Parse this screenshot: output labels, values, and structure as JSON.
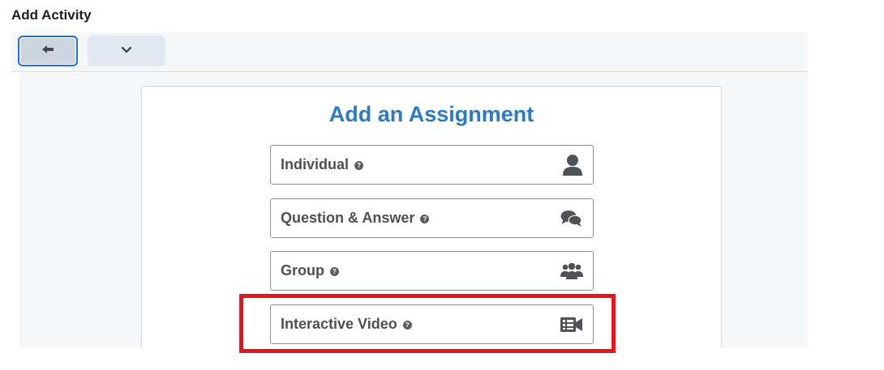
{
  "page": {
    "title": "Add Activity"
  },
  "toolbar": {
    "back_icon": "arrow-left-icon",
    "menu_icon": "chevron-down-icon"
  },
  "assignment": {
    "heading": "Add an Assignment",
    "options": [
      {
        "label": "Individual",
        "help": "?",
        "icon": "person-icon"
      },
      {
        "label": "Question & Answer",
        "help": "?",
        "icon": "chat-bubbles-icon"
      },
      {
        "label": "Group",
        "help": "?",
        "icon": "group-icon"
      },
      {
        "label": "Interactive Video",
        "help": "?",
        "icon": "video-camera-icon"
      }
    ]
  },
  "colors": {
    "heading": "#2a7ac9",
    "highlight": "#e5161e",
    "focus_border": "#2c6fbb"
  }
}
